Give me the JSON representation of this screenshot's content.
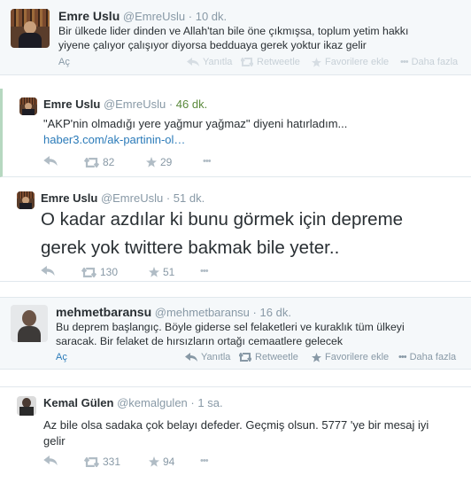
{
  "tweets": [
    {
      "name": "Emre Uslu",
      "handle": "@EmreUslu",
      "time": "10 dk.",
      "lines": [
        "Bir ülkede lider dinden ve Allah'tan bile öne çıkmışsa, toplum yetim hakkı",
        "yiyene çalıyor çalışıyor diyorsa bedduaya gerek yoktur ikaz gelir"
      ],
      "expand": "Aç",
      "actions": {
        "reply": "Yanıtla",
        "retweet": "Retweetle",
        "favorite": "Favorilere ekle",
        "more": "Daha fazla"
      }
    },
    {
      "name": "Emre Uslu",
      "handle": "@EmreUslu",
      "time": "46 dk.",
      "lines": [
        "\"AKP'nin olmadığı yere yağmur yağmaz\" diyeni hatırladım..."
      ],
      "link": "haber3.com/ak-partinin-ol…",
      "retweets": "82",
      "favorites": "29",
      "more": "•••"
    },
    {
      "name": "Emre Uslu",
      "handle": "@EmreUslu",
      "time": "51 dk.",
      "lines": [
        "O kadar azdılar ki bunu görmek için depreme",
        "gerek yok twittere bakmak bile yeter.."
      ],
      "retweets": "130",
      "favorites": "51",
      "more": "•••"
    },
    {
      "name": "mehmetbaransu",
      "handle": "@mehmetbaransu",
      "time": "16 dk.",
      "lines": [
        "Bu deprem başlangıç. Böyle giderse sel felaketleri ve kuraklık tüm ülkeyi",
        "saracak. Bir felaket de hırsızların ortağı cemaatlere gelecek"
      ],
      "expand": "Aç",
      "actions": {
        "reply": "Yanıtla",
        "retweet": "Retweetle",
        "favorite": "Favorilere ekle",
        "more": "Daha fazla"
      }
    },
    {
      "name": "Kemal Gülen",
      "handle": "@kemalgulen",
      "time": "1 sa.",
      "lines": [
        "Az bile olsa sadaka çok belayı defeder. Geçmiş olsun. 5777 'ye bir mesaj iyi",
        "gelir"
      ],
      "retweets": "331",
      "favorites": "94",
      "more": "•••"
    }
  ],
  "colors": {
    "link": "#2b7bb9",
    "muted": "#8899a6",
    "card_bg": "#f5f8fa",
    "accent_green": "#5b8a3c"
  }
}
